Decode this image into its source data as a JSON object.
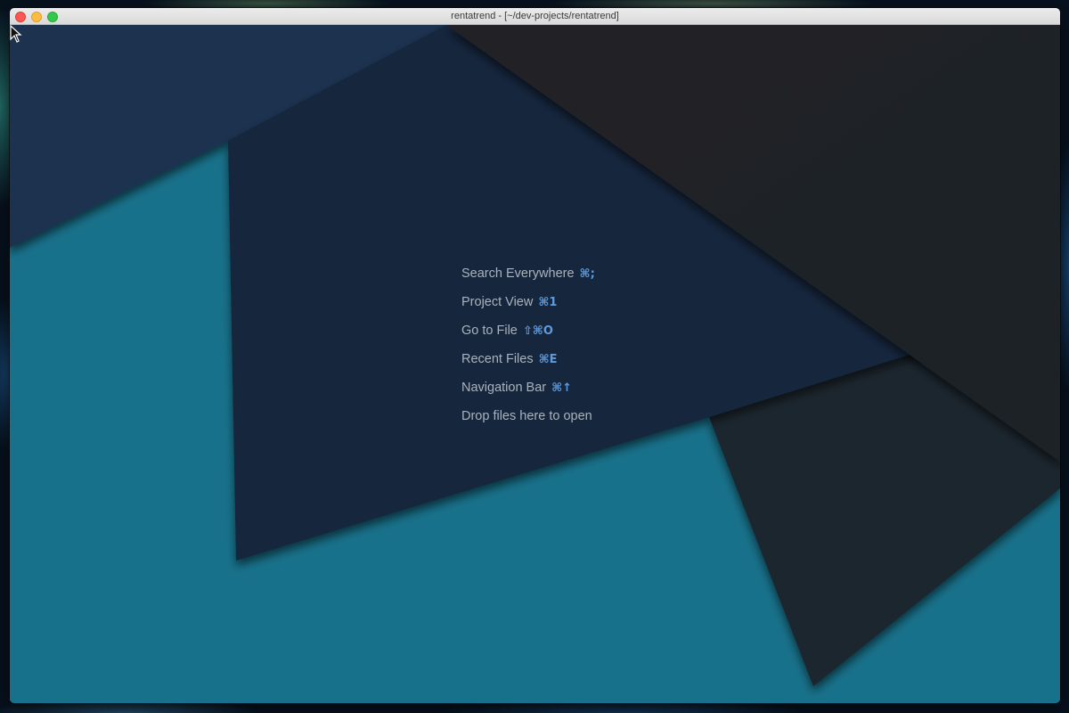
{
  "window": {
    "title": "rentatrend - [~/dev-projects/rentatrend]"
  },
  "hints": [
    {
      "label": "Search Everywhere",
      "shortcut": "⌘;"
    },
    {
      "label": "Project View",
      "shortcut": "⌘1"
    },
    {
      "label": "Go to File",
      "shortcut": "⇧⌘O"
    },
    {
      "label": "Recent Files",
      "shortcut": "⌘E"
    },
    {
      "label": "Navigation Bar",
      "shortcut": "⌘↑"
    },
    {
      "label": "Drop files here to open",
      "shortcut": ""
    }
  ],
  "colors": {
    "background_teal": "#18718a",
    "panel_navy": "#14273f",
    "panel_dark": "#1e2630",
    "hint_text": "#a9b3bd",
    "shortcut_blue": "#5e9bdc"
  }
}
